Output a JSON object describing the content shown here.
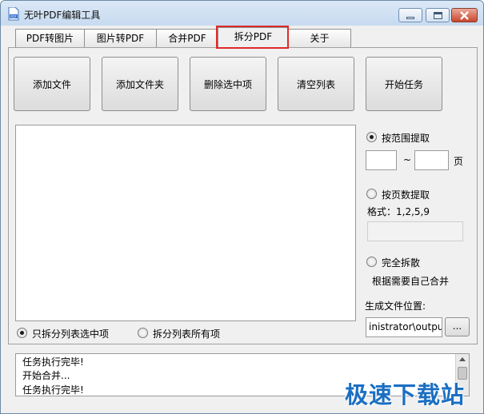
{
  "window": {
    "title": "无叶PDF编辑工具"
  },
  "tabs": [
    {
      "label": "PDF转图片"
    },
    {
      "label": "图片转PDF"
    },
    {
      "label": "合并PDF"
    },
    {
      "label": "拆分PDF"
    },
    {
      "label": "关于"
    }
  ],
  "toolbar": {
    "add_file": "添加文件",
    "add_folder": "添加文件夹",
    "delete_selected": "删除选中项",
    "clear_list": "清空列表",
    "start_task": "开始任务"
  },
  "options": {
    "by_range_label": "按范围提取",
    "range_from": "",
    "range_tilde": "~",
    "range_to": "",
    "page_unit": "页",
    "by_pages_label": "按页数提取",
    "format_label": "格式：1,2,5,9",
    "pages_value": "",
    "split_all_label": "完全拆散",
    "split_all_note": "根据需要自己合并",
    "output_location_label": "生成文件位置:",
    "output_path": "inistrator\\output",
    "browse_label": "..."
  },
  "scope": {
    "selected_only": "只拆分列表选中项",
    "all_items": "拆分列表所有项"
  },
  "log": {
    "lines": [
      "任务执行完毕!",
      "开始合并...",
      "任务执行完毕!"
    ]
  },
  "watermark": {
    "text": "极速下载站"
  },
  "colors": {
    "tab_highlight": "#e02a2a",
    "watermark": "#1b6fc2"
  }
}
